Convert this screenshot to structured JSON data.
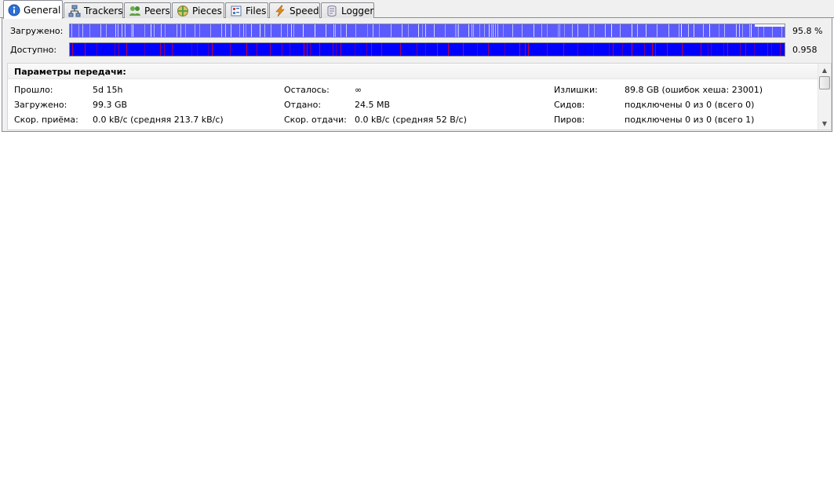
{
  "tabs": [
    {
      "label": "General",
      "icon": "info-icon",
      "active": true
    },
    {
      "label": "Trackers",
      "icon": "network-icon"
    },
    {
      "label": "Peers",
      "icon": "peers-icon"
    },
    {
      "label": "Pieces",
      "icon": "pieces-icon"
    },
    {
      "label": "Files",
      "icon": "files-icon"
    },
    {
      "label": "Speed",
      "icon": "lightning-icon"
    },
    {
      "label": "Logger",
      "icon": "scroll-icon"
    }
  ],
  "progress": {
    "downloaded_label": "Загружено:",
    "downloaded_value": "95.8 %",
    "downloaded_fraction": 0.958,
    "available_label": "Доступно:",
    "available_value": "0.958"
  },
  "transfer": {
    "title": "Параметры передачи:",
    "col1": [
      {
        "label": "Прошло:",
        "value": "5d 15h"
      },
      {
        "label": "Загружено:",
        "value": "99.3 GB"
      },
      {
        "label": "Скор. приёма:",
        "value": "0.0 kB/c (средняя 213.7 kB/c)"
      }
    ],
    "col2": [
      {
        "label": "Осталось:",
        "value": "∞"
      },
      {
        "label": "Отдано:",
        "value": "24.5 MB"
      },
      {
        "label": "Скор. отдачи:",
        "value": "0.0 kB/c (средняя 52 B/c)"
      }
    ],
    "col3": [
      {
        "label": "Излишки:",
        "value": "89.8 GB (ошибок хеша: 23001)"
      },
      {
        "label": "Сидов:",
        "value": "подключены 0 из 0 (всего 0)"
      },
      {
        "label": "Пиров:",
        "value": "подключены 0 из 0 (всего 1)"
      }
    ]
  },
  "colors": {
    "downloaded_bar": "#5a5aff",
    "available_bar": "#0000ff",
    "piece_gap": "#ffffff",
    "piece_missing": "#ff0000"
  }
}
